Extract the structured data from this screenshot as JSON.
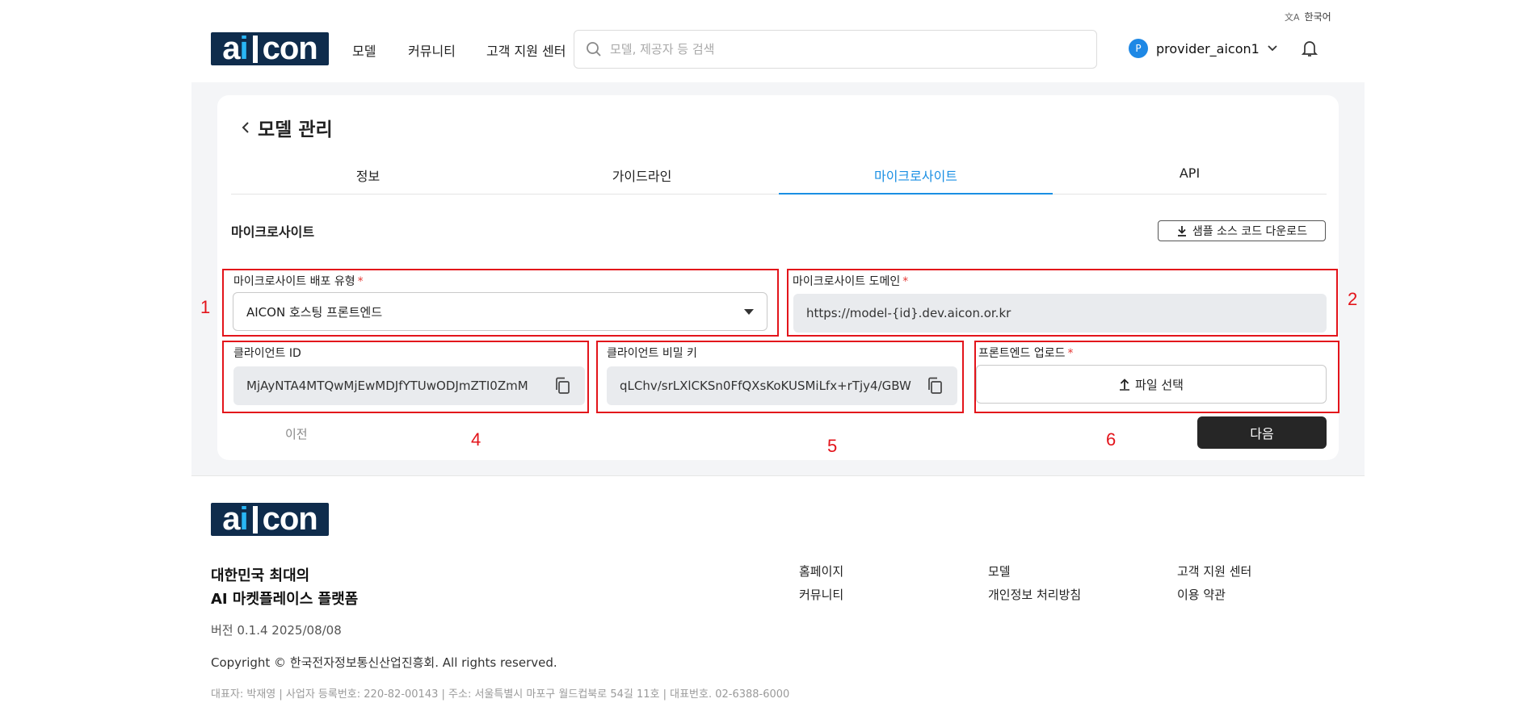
{
  "language": {
    "icon": "translate-icon",
    "label": "한국어"
  },
  "header": {
    "logo_text": "ai con",
    "nav": [
      "모델",
      "커뮤니티",
      "고객 지원 센터"
    ],
    "search_placeholder": "모델, 제공자 등 검색",
    "user_initial": "P",
    "username": "provider_aicon1"
  },
  "page": {
    "title": "모델 관리",
    "tabs": [
      "정보",
      "가이드라인",
      "마이크로사이트",
      "API"
    ],
    "active_tab": "마이크로사이트",
    "section_title": "마이크로사이트",
    "download_label": "샘플 소스 코드 다운로드"
  },
  "form": {
    "deploy_type_label": "마이크로사이트 배포 유형",
    "deploy_type_value": "AICON 호스팅 프론트엔드",
    "domain_label": "마이크로사이트 도메인",
    "domain_value": "https://model-{id}.dev.aicon.or.kr",
    "client_id_label": "클라이언트 ID",
    "client_id_value": "MjAyNTA4MTQwMjEwMDJfYTUwODJmZTI0ZmM",
    "client_secret_label": "클라이언트 비밀 키",
    "client_secret_value": "qLChv/srLXlCKSn0FfQXsKoKUSMiLfx+rTjy4/GBW",
    "upload_label": "프론트엔드 업로드",
    "upload_button": "파일 선택",
    "required_mark": "*"
  },
  "actions": {
    "prev": "이전",
    "next": "다음"
  },
  "annotations": [
    "1",
    "2",
    "4",
    "5",
    "6"
  ],
  "footer": {
    "logo_text": "ai con",
    "tagline_1": "대한민국 최대의",
    "tagline_2": "AI 마켓플레이스 플랫폼",
    "version": "버전 0.1.4 2025/08/08",
    "copyright": "Copyright © 한국전자정보통신산업진흥회. All rights reserved.",
    "company_info": "대표자: 박재영 | 사업자 등록번호: 220-82-00143 | 주소: 서울특별시 마포구 월드컵북로 54길 11호 | 대표번호. 02-6388-6000",
    "links": [
      "홈페이지",
      "모델",
      "고객 지원 센터",
      "커뮤니티",
      "개인정보 처리방침",
      "이용 약관"
    ]
  },
  "colors": {
    "accent": "#1a8fe3",
    "annotation": "#e3141b",
    "brand_navy": "#0f2c4c",
    "primary_button": "#262626"
  }
}
